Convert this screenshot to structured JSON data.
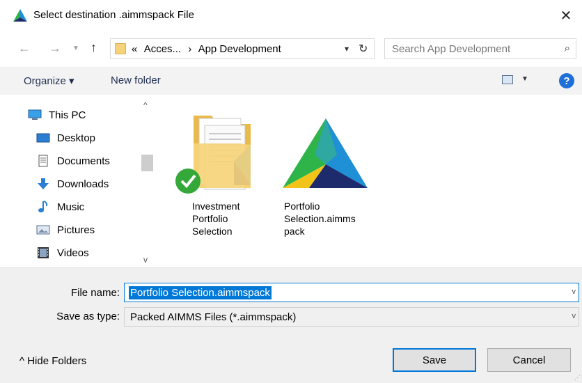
{
  "window": {
    "title": "Select destination .aimmspack File",
    "close_glyph": "✕"
  },
  "nav": {
    "back_glyph": "←",
    "forward_glyph": "→",
    "recent_glyph": "▼",
    "up_glyph": "↑"
  },
  "address": {
    "crumbs": [
      "«",
      "Acces...",
      "›",
      "App Development"
    ],
    "dropdown_glyph": "▾",
    "refresh_glyph": "↻"
  },
  "search": {
    "placeholder": "Search App Development",
    "icon": "⌕"
  },
  "toolbar": {
    "organize_label": "Organize ▾",
    "new_folder_label": "New folder",
    "view_dropdown_glyph": "▼",
    "help_label": "?"
  },
  "sidebar": {
    "items": [
      {
        "label": "This PC",
        "icon": "pc-icon"
      },
      {
        "label": "Desktop",
        "icon": "desktop-icon"
      },
      {
        "label": "Documents",
        "icon": "documents-icon"
      },
      {
        "label": "Downloads",
        "icon": "downloads-icon"
      },
      {
        "label": "Music",
        "icon": "music-icon"
      },
      {
        "label": "Pictures",
        "icon": "pictures-icon"
      },
      {
        "label": "Videos",
        "icon": "videos-icon"
      }
    ],
    "scroll_up_glyph": "^",
    "scroll_down_glyph": "v"
  },
  "files": [
    {
      "label": "Investment\nPortfolio\nSelection",
      "type": "folder"
    },
    {
      "label": "Portfolio\nSelection.aimms\npack",
      "type": "aimms"
    }
  ],
  "bottom": {
    "file_name_label": "File name:",
    "file_name_value": "Portfolio Selection.aimmspack",
    "save_type_label": "Save as type:",
    "save_type_value": "Packed AIMMS Files (*.aimmspack)",
    "dropdown_glyph": "v",
    "hide_folders_label": "^  Hide Folders",
    "save_label": "Save",
    "cancel_label": "Cancel"
  },
  "colors": {
    "accent": "#0078d7",
    "toolbar_bg": "#f3f3f3",
    "bottom_bg": "#f0f0f0"
  }
}
